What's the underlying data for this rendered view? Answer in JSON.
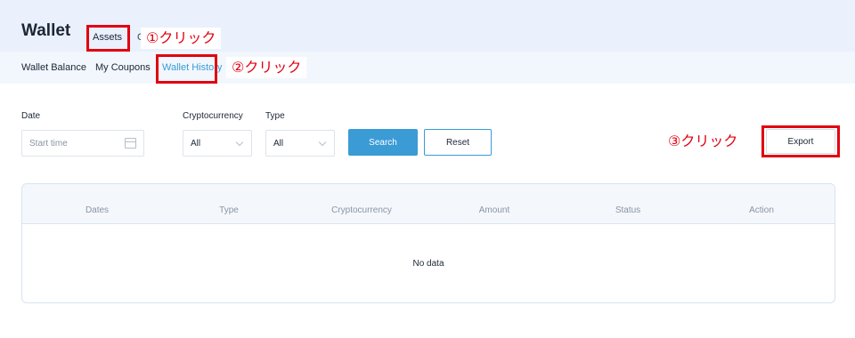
{
  "header": {
    "brand": "Wallet",
    "tabs": [
      {
        "label": "Assets"
      },
      {
        "label": "C"
      }
    ]
  },
  "subnav": {
    "items": [
      {
        "label": "Wallet Balance"
      },
      {
        "label": "My Coupons"
      },
      {
        "label": "Wallet History",
        "active": true
      }
    ]
  },
  "filters": {
    "date_label": "Date",
    "date_placeholder": "Start time",
    "crypto_label": "Cryptocurrency",
    "crypto_value": "All",
    "type_label": "Type",
    "type_value": "All",
    "search_label": "Search",
    "reset_label": "Reset",
    "export_label": "Export"
  },
  "table": {
    "columns": [
      "Dates",
      "Type",
      "Cryptocurrency",
      "Amount",
      "Status",
      "Action"
    ],
    "empty_text": "No data"
  },
  "annotations": {
    "step1": "①クリック",
    "step2": "②クリック",
    "step3": "③クリック"
  },
  "colors": {
    "accent": "#3a9bd5",
    "annotation": "#e10010",
    "header_bg": "#eaf1fc"
  }
}
